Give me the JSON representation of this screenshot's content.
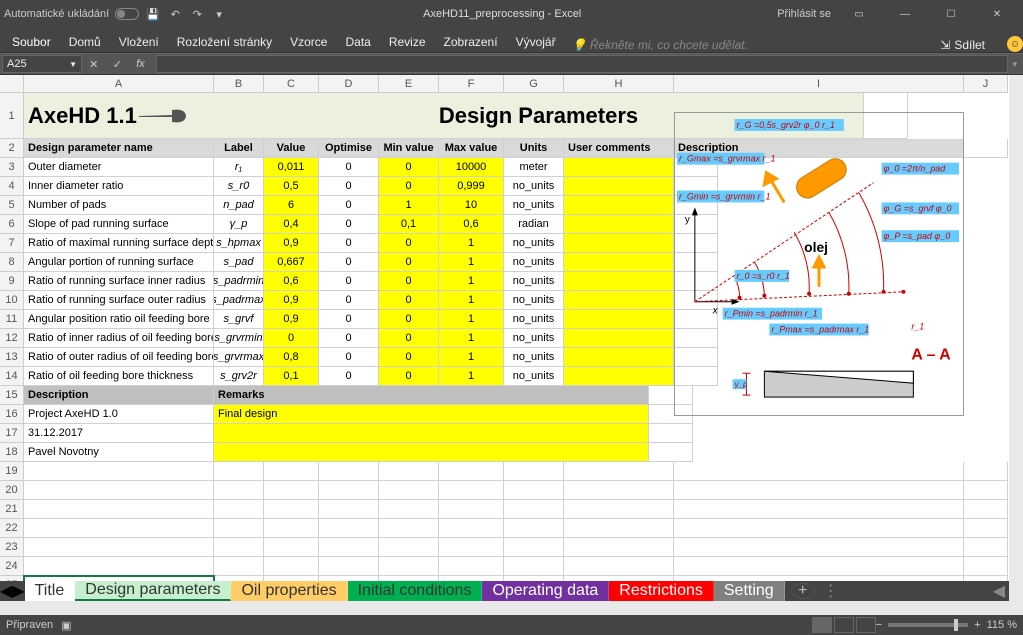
{
  "window": {
    "autosave_label": "Automatické ukládání",
    "title": "AxeHD11_preprocessing  -  Excel",
    "signin": "Přihlásit se"
  },
  "ribbon": {
    "tabs": [
      "Soubor",
      "Domů",
      "Vložení",
      "Rozložení stránky",
      "Vzorce",
      "Data",
      "Revize",
      "Zobrazení",
      "Vývojář"
    ],
    "tell_me": "Řekněte mi, co chcete udělat.",
    "share": "Sdílet"
  },
  "namebox": "A25",
  "columns": [
    "A",
    "B",
    "C",
    "D",
    "E",
    "F",
    "G",
    "H",
    "I",
    "J"
  ],
  "title_cell": "AxeHD 1.1",
  "merged_title": "Design Parameters",
  "headers": {
    "a": "Design parameter name",
    "b": "Label",
    "c": "Value",
    "d": "Optimise",
    "e": "Min value",
    "f": "Max value",
    "g": "Units",
    "h": "User comments",
    "i": "Description"
  },
  "params": [
    {
      "name": "Outer diameter",
      "label": "r₁",
      "value": "0,011",
      "opt": "0",
      "min": "0",
      "max": "10000",
      "units": "meter"
    },
    {
      "name": "Inner diameter ratio",
      "label": "s_r0",
      "value": "0,5",
      "opt": "0",
      "min": "0",
      "max": "0,999",
      "units": "no_units"
    },
    {
      "name": "Number of pads",
      "label": "n_pad",
      "value": "6",
      "opt": "0",
      "min": "1",
      "max": "10",
      "units": "no_units"
    },
    {
      "name": "Slope of pad running surface",
      "label": "γ_p",
      "value": "0,4",
      "opt": "0",
      "min": "0,1",
      "max": "0,6",
      "units": "radian"
    },
    {
      "name": "Ratio of maximal running surface depth",
      "label": "s_hpmax",
      "value": "0,9",
      "opt": "0",
      "min": "0",
      "max": "1",
      "units": "no_units"
    },
    {
      "name": "Angular portion of running surface",
      "label": "s_pad",
      "value": "0,667",
      "opt": "0",
      "min": "0",
      "max": "1",
      "units": "no_units"
    },
    {
      "name": "Ratio of running surface inner radius",
      "label": "s_padrmin",
      "value": "0,6",
      "opt": "0",
      "min": "0",
      "max": "1",
      "units": "no_units"
    },
    {
      "name": "Ratio of running surface outer radius",
      "label": "s_padrmax",
      "value": "0,9",
      "opt": "0",
      "min": "0",
      "max": "1",
      "units": "no_units"
    },
    {
      "name": "Angular position ratio oil feeding bore",
      "label": "s_grvf",
      "value": "0,9",
      "opt": "0",
      "min": "0",
      "max": "1",
      "units": "no_units"
    },
    {
      "name": "Ratio of inner radius of oil feeding bore",
      "label": "s_grvrmin",
      "value": "0",
      "opt": "0",
      "min": "0",
      "max": "1",
      "units": "no_units"
    },
    {
      "name": "Ratio of outer radius of oil feeding bore",
      "label": "s_grvrmax",
      "value": "0,8",
      "opt": "0",
      "min": "0",
      "max": "1",
      "units": "no_units"
    },
    {
      "name": "Ratio of oil feeding bore thickness",
      "label": "s_grv2r",
      "value": "0,1",
      "opt": "0",
      "min": "0",
      "max": "1",
      "units": "no_units"
    }
  ],
  "desc_header_a": "Description",
  "desc_header_b": "Remarks",
  "desc_rows": [
    {
      "a": "Project AxeHD 1.0",
      "b": "Final design"
    },
    {
      "a": "31.12.2017",
      "b": ""
    },
    {
      "a": "Pavel Novotny",
      "b": ""
    }
  ],
  "diagram": {
    "olej": "olej",
    "section": "A – A",
    "labels": {
      "rg": "r_G =0,5s_grv2r φ_0 r_1",
      "rgmax": "r_Gmax =s_grvrmax r_1",
      "rgmin": "r_Gmin =s_grvrmin r_1",
      "phi0": "φ_0 =2π/n_pad",
      "phig": "φ_G =s_grvf φ_0",
      "phip": "φ_P =s_pad φ_0",
      "r0": "r_0 =s_r0 r_1",
      "rpmin": "r_Pmin =s_padrmin r_1",
      "rpmax": "r_Pmax =s_padrmax r_1",
      "r1": "r_1",
      "gammap": "γ_p",
      "x": "x",
      "y": "y"
    }
  },
  "sheet_tabs": [
    {
      "label": "Title",
      "color": "#ffffff"
    },
    {
      "label": "Design parameters",
      "color": "#c6efce",
      "active": true
    },
    {
      "label": "Oil properties",
      "color": "#ffcc66"
    },
    {
      "label": "Initial conditions",
      "color": "#00b050"
    },
    {
      "label": "Operating data",
      "color": "#7030a0",
      "fg": "#fff"
    },
    {
      "label": "Restrictions",
      "color": "#ff0000",
      "fg": "#fff"
    },
    {
      "label": "Setting",
      "color": "#808080",
      "fg": "#fff"
    }
  ],
  "status": {
    "ready": "Připraven",
    "zoom": "115 %"
  }
}
